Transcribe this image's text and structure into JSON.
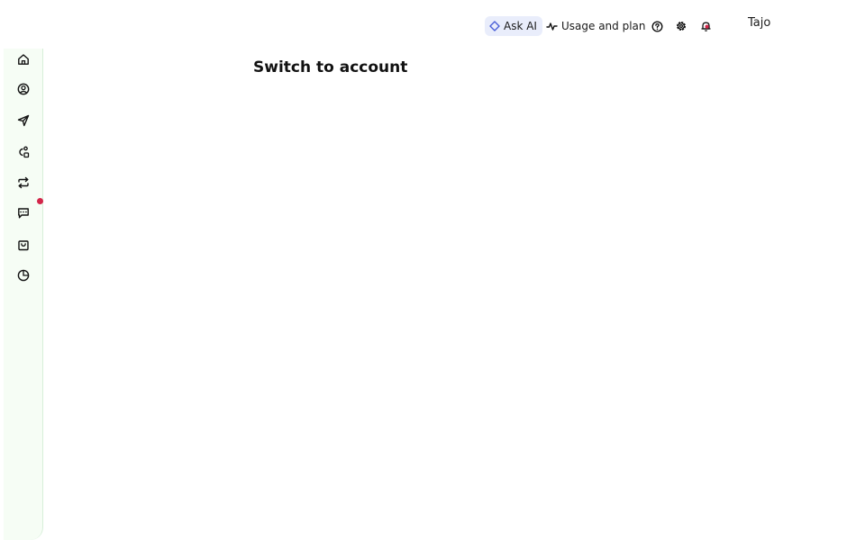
{
  "header": {
    "ask_ai_label": "Ask AI",
    "usage_label": "Usage and plan",
    "user_name": "Tajo",
    "icons": [
      "sparkle-icon",
      "activity-icon",
      "help-icon",
      "gear-icon",
      "bell-icon"
    ]
  },
  "sidebar": {
    "items": [
      {
        "icon": "home-icon"
      },
      {
        "icon": "user-circle-icon"
      },
      {
        "icon": "send-icon"
      },
      {
        "icon": "shapes-icon"
      },
      {
        "icon": "repeat-icon"
      },
      {
        "icon": "message-icon",
        "badge": true
      },
      {
        "icon": "shopping-bag-icon"
      },
      {
        "icon": "pie-chart-icon"
      }
    ]
  },
  "main": {
    "title": "Switch to account"
  },
  "colors": {
    "sidebar_bg": "#f6fdf5",
    "sidebar_border": "#d7efd8",
    "ask_ai_bg": "#e9edfb",
    "ask_ai_accent": "#4a5fd8",
    "badge": "#d3264a"
  }
}
